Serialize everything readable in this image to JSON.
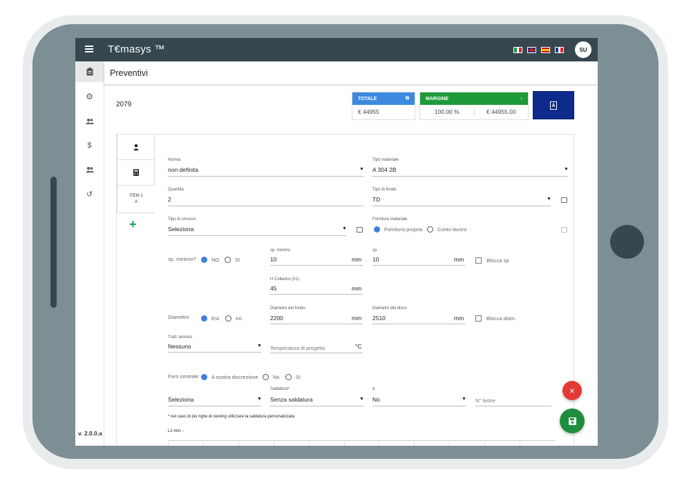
{
  "app": {
    "title": "T€masys ™",
    "user_initials": "SU",
    "version": "v. 2.0.0.a"
  },
  "page": {
    "title": "Preventivi",
    "doc_number": "2079"
  },
  "totals": {
    "totale_label": "TOTALE",
    "totale_value": "€ 44955",
    "margine_label": "MARGINE",
    "margine_pct": "100.00 %",
    "margine_value": "€ 44955.00",
    "totale_color": "#3b8ae0",
    "margine_color": "#1f9a3a",
    "pdf_color": "#0d2a8c"
  },
  "tabs": {
    "item_label_1": "ITEM 1",
    "item_label_2": "A"
  },
  "form": {
    "norma_label": "Norma",
    "norma_value": "non definita",
    "tipo_materiale_label": "Tipo materiale",
    "tipo_materiale_value": "A 304 2B",
    "quantita_label": "Quantità",
    "quantita_value": "2",
    "tipo_fondo_label": "Tipo di fondo",
    "tipo_fondo_value": "TD",
    "tipo_smusso_label": "Tipo di smusso",
    "tipo_smusso_value": "Seleziona",
    "fornitura_label": "Fornitura materiale",
    "fornitura_opt1": "Fornitura propria",
    "fornitura_opt2": "Conto lavoro",
    "sp_minimo_q": "sp. minimo?",
    "no": "NO",
    "si": "SI",
    "sp_minimo_label": "sp. minimo",
    "sp_minimo_value": "10",
    "mm": "mm",
    "sp_label": "sp",
    "sp_value": "10",
    "blocca_sp": "Blocca sp",
    "h_collarino_label": "H Collarino (h1)",
    "h_collarino_value": "45",
    "diametro": "Diametro",
    "est": "Est.",
    "int": "Int.",
    "diam_fondo_label": "Diametro del fondo",
    "diam_fondo_value": "2200",
    "diam_disco_label": "Diametro del disco",
    "diam_disco_value": "2510",
    "blocca_diam": "Blocca diam.",
    "tratt_label": "Tratt. termico",
    "tratt_value": "Nessuno",
    "temp_placeholder": "Temperatura di progetto",
    "temp_unit": "°C",
    "foro_label": "Foro centrale",
    "foro_opt1": "A nostra discrezione",
    "foro_opt2": "No",
    "foro_opt3": "Si",
    "seleziona": "Seleziona",
    "saldatura_label": "Saldatura*",
    "saldatura_value": "Senza saldatura",
    "alpha_label": "α",
    "alpha_value": "No",
    "n_lastre_placeholder": "N° lastre",
    "note": "* nel caso di più righe di nesting utilizzare la saldatura personalizzata",
    "l2_min": "L2 min: -"
  }
}
